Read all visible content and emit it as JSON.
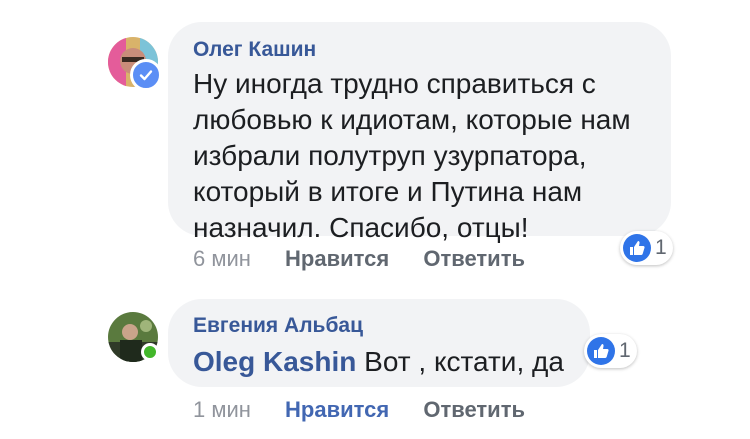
{
  "comments": [
    {
      "author": "Олег Кашин",
      "text_lines": [
        "Ну иногда трудно справиться с",
        "любовью к идиотам, которые нам",
        "избрали полутруп узурпатора,",
        "который в итоге и Путина нам",
        "назначил. Спасибо, отцы!"
      ],
      "time": "6 мин",
      "like_label": "Нравится",
      "reply_label": "Ответить",
      "reaction_count": "1"
    },
    {
      "author": "Евгения Альбац",
      "mention": "Oleg Kashin",
      "text": " Вот , кстати, да",
      "time": "1 мин",
      "like_label": "Нравится",
      "reply_label": "Ответить",
      "reaction_count": "1"
    }
  ],
  "colors": {
    "bubble": "#f2f3f5",
    "author": "#385898",
    "like_active": "#4267b2",
    "reaction_blue": "#2f74e8",
    "online": "#42b72a"
  }
}
